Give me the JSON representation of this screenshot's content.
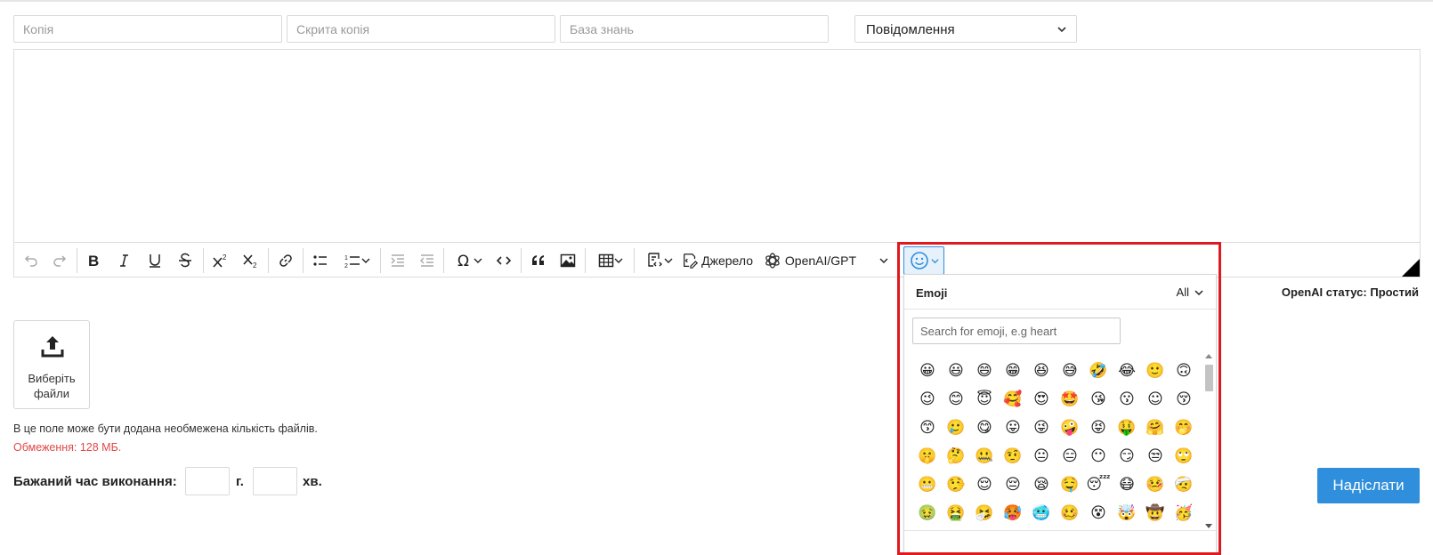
{
  "recipients": {
    "cc_placeholder": "Копія",
    "bcc_placeholder": "Скрита копія",
    "kb_placeholder": "База знань",
    "type_value": "Повідомлення"
  },
  "toolbar": {
    "source_label": "Джерело",
    "openai_label": "OpenAI/GPT"
  },
  "openai_status": "OpenAI статус: Простий",
  "upload": {
    "label": "Виберіть файли"
  },
  "files_info": "В це поле може бути додана необмежена кількість файлів.",
  "files_limit": "Обмеження: 128 МБ.",
  "time": {
    "label": "Бажаний час виконання:",
    "hours_unit": "г.",
    "minutes_unit": "хв."
  },
  "submit_label": "Надіслати",
  "emoji_panel": {
    "title": "Emoji",
    "category": "All",
    "search_placeholder": "Search for emoji, e.g heart",
    "emojis": [
      "😀",
      "😃",
      "😄",
      "😁",
      "😆",
      "😅",
      "🤣",
      "😂",
      "🙂",
      "🙃",
      "😉",
      "😊",
      "😇",
      "🥰",
      "😍",
      "🤩",
      "😘",
      "😗",
      "☺",
      "😚",
      "😙",
      "🥲",
      "😋",
      "😛",
      "😜",
      "🤪",
      "😝",
      "🤑",
      "🤗",
      "🤭",
      "🤫",
      "🤔",
      "🤐",
      "🤨",
      "😐",
      "😑",
      "😶",
      "😏",
      "😒",
      "🙄",
      "😬",
      "🤥",
      "😌",
      "😔",
      "😪",
      "🤤",
      "😴",
      "😷",
      "🤒",
      "🤕",
      "🤢",
      "🤮",
      "🤧",
      "🥵",
      "🥶",
      "🥴",
      "😵",
      "🤯",
      "🤠",
      "🥳"
    ]
  },
  "colors": {
    "accent": "#2f8fdc",
    "highlight": "#e0181f",
    "warning_text": "#e04848"
  }
}
